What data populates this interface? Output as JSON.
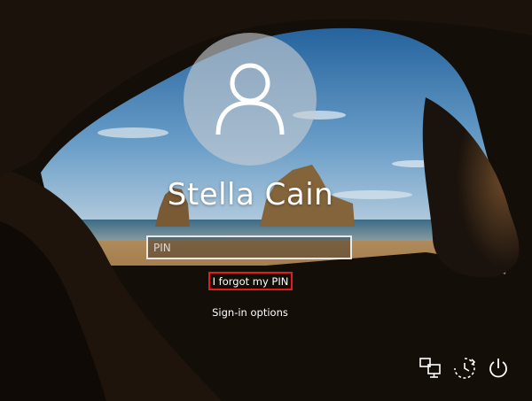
{
  "user": {
    "name": "Stella Cain"
  },
  "pin_field": {
    "placeholder": "PIN",
    "value": ""
  },
  "links": {
    "forgot_pin": "I forgot my PIN",
    "sign_in_options": "Sign-in options"
  },
  "system_icons": [
    "network-icon",
    "ease-of-access-icon",
    "power-icon"
  ],
  "colors": {
    "highlight_border": "#e01e1e",
    "avatar_circle": "#c8cdd2"
  }
}
